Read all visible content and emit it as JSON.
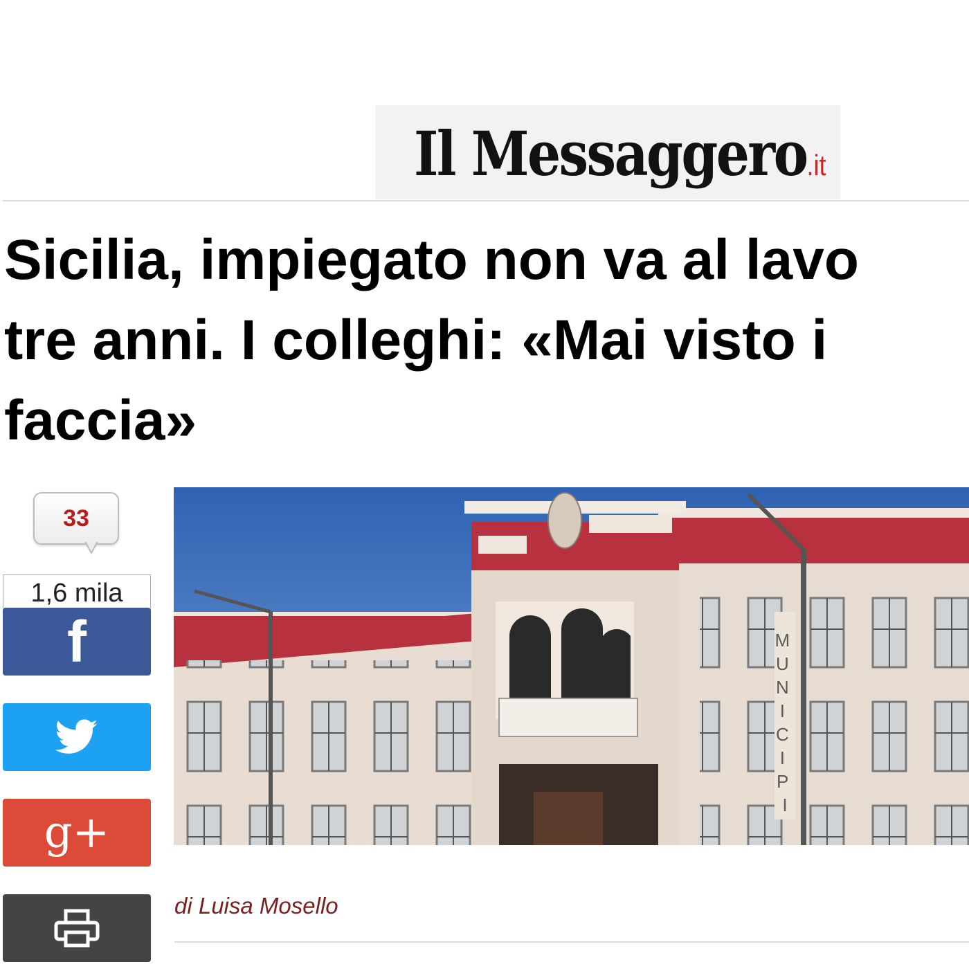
{
  "masthead": {
    "brand": "Il Messaggero",
    "tld": ".it"
  },
  "headline": {
    "lines": [
      "Sicilia, impiegato non va al lavo",
      "tre anni. I colleghi: «Mai visto i",
      "faccia»"
    ]
  },
  "comments": {
    "count": "33",
    "icon": "speech-bubble-icon"
  },
  "share": {
    "count": "1,6 mila",
    "buttons": [
      {
        "name": "facebook",
        "icon": "facebook-icon",
        "color": "#3b5998"
      },
      {
        "name": "twitter",
        "icon": "twitter-bird-icon",
        "color": "#1da1f2"
      },
      {
        "name": "google-plus",
        "icon": "google-plus-icon",
        "color": "#dc4a38"
      },
      {
        "name": "print",
        "icon": "printer-icon",
        "color": "#444444"
      }
    ]
  },
  "photo": {
    "sign_text": "MUNICIPI"
  },
  "byline": "di Luisa Mosello",
  "colors": {
    "accent": "#c62828",
    "byline": "#7a1f1f",
    "building_red": "#b8313e"
  }
}
